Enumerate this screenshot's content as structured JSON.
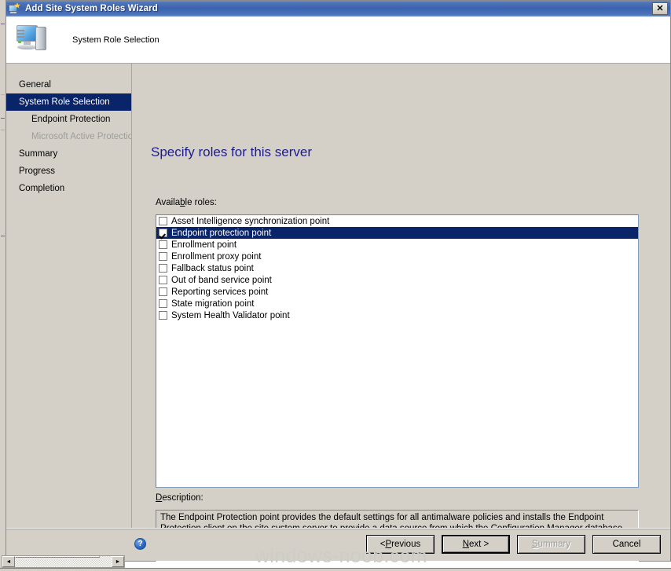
{
  "window": {
    "title": "Add Site System Roles Wizard",
    "icon": "site-system-roles-icon",
    "close_label": "✕"
  },
  "header": {
    "title": "System Role Selection",
    "icon": "computer-monitor-icon"
  },
  "sidebar": {
    "items": [
      {
        "label": "General",
        "state": "normal",
        "indent": false
      },
      {
        "label": "System Role Selection",
        "state": "selected",
        "indent": false
      },
      {
        "label": "Endpoint Protection",
        "state": "normal",
        "indent": true
      },
      {
        "label": "Microsoft Active Protection Service",
        "state": "disabled",
        "indent": true
      },
      {
        "label": "Summary",
        "state": "normal",
        "indent": false
      },
      {
        "label": "Progress",
        "state": "normal",
        "indent": false
      },
      {
        "label": "Completion",
        "state": "normal",
        "indent": false
      }
    ]
  },
  "main": {
    "heading": "Specify roles for this server",
    "available_roles_label_pre": "Availa",
    "available_roles_label_acc": "b",
    "available_roles_label_post": "le roles:",
    "roles": [
      {
        "label": "Asset Intelligence synchronization point",
        "checked": false,
        "selected": false
      },
      {
        "label": "Endpoint protection point",
        "checked": true,
        "selected": true
      },
      {
        "label": "Enrollment point",
        "checked": false,
        "selected": false
      },
      {
        "label": "Enrollment proxy point",
        "checked": false,
        "selected": false
      },
      {
        "label": "Fallback status point",
        "checked": false,
        "selected": false
      },
      {
        "label": "Out of band service point",
        "checked": false,
        "selected": false
      },
      {
        "label": "Reporting services point",
        "checked": false,
        "selected": false
      },
      {
        "label": "State migration point",
        "checked": false,
        "selected": false
      },
      {
        "label": "System Health Validator point",
        "checked": false,
        "selected": false
      }
    ],
    "description_label_pre": "",
    "description_label_acc": "D",
    "description_label_post": "escription:",
    "description_text": "The Endpoint Protection point provides the default settings for all antimalware policies and installs the Endpoint Protection client on the site system server to provide a data source from which the Configuration Manager database resolves malware IDs to names. When you install this site system role, you must accept the end user license terms for System Center 2012 Endpoint Protection."
  },
  "footer": {
    "help_icon": "help-question-icon",
    "help_glyph": "?",
    "buttons": [
      {
        "name": "previous",
        "pre": "< ",
        "acc": "P",
        "post": "revious",
        "state": "normal"
      },
      {
        "name": "next",
        "pre": "",
        "acc": "N",
        "post": "ext >",
        "state": "default"
      },
      {
        "name": "summary",
        "pre": "",
        "acc": "S",
        "post": "ummary",
        "state": "disabled"
      },
      {
        "name": "cancel",
        "pre": "",
        "acc": "",
        "post": "Cancel",
        "state": "normal"
      }
    ]
  },
  "watermark": {
    "text": "windows-noob.com"
  },
  "background_window": {
    "scrollbar": {
      "left_arrow": "◄",
      "right_arrow": "►"
    }
  },
  "colors": {
    "titlebar_blue": "#3b62ae",
    "selection_navy": "#0a246a",
    "heading_blue": "#1c1c8c",
    "dialog_face": "#d4d0c8",
    "disabled_text": "#9d9d99",
    "watermark_gray": "#cdcdc7"
  }
}
